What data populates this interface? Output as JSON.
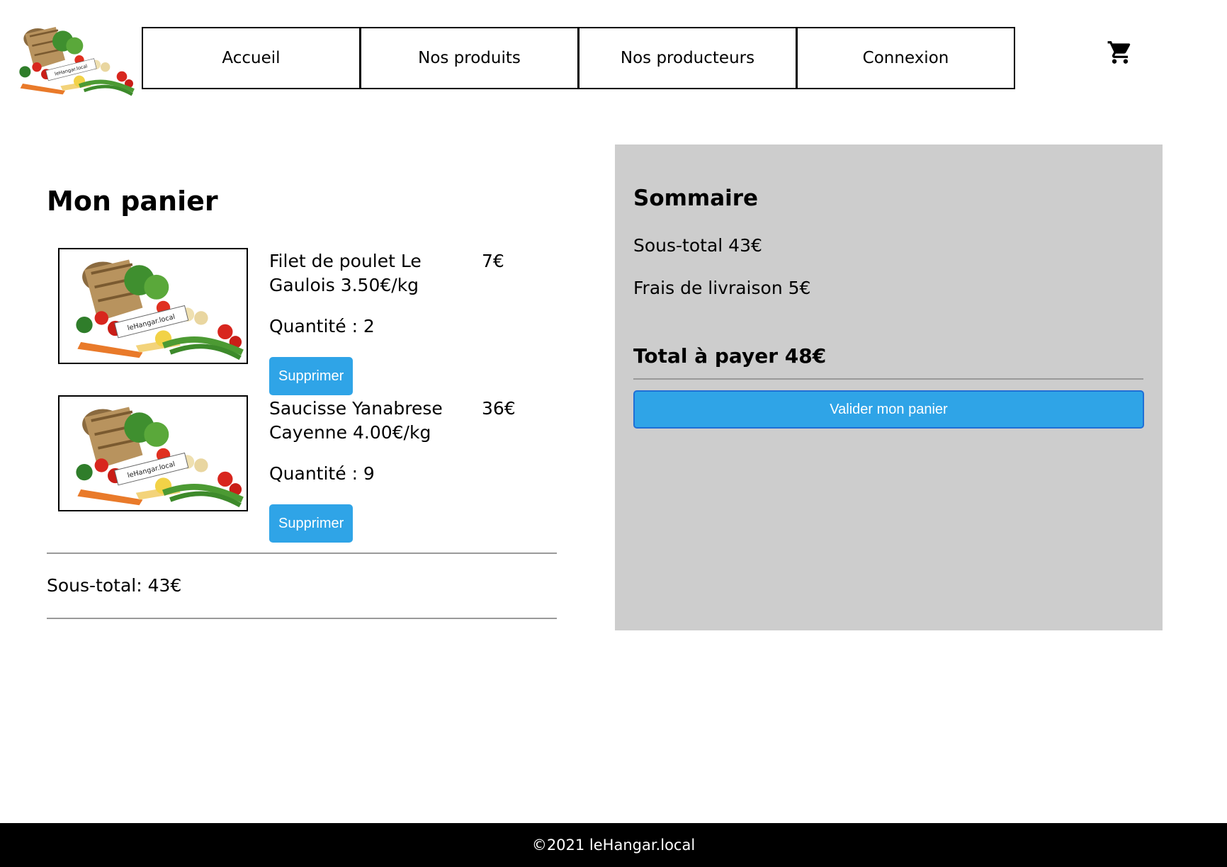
{
  "header": {
    "nav": [
      "Accueil",
      "Nos produits",
      "Nos producteurs",
      "Connexion"
    ],
    "logo_icon": "vegetable-basket-logo",
    "cart_icon": "shopping-cart-icon"
  },
  "cart": {
    "title": "Mon panier",
    "items": [
      {
        "name": "Filet de poulet Le Gaulois 3.50€/kg",
        "price": "7€",
        "quantity": "Quantité : 2",
        "delete_label": "Supprimer"
      },
      {
        "name": "Saucisse Yanabrese Cayenne 4.00€/kg",
        "price": "36€",
        "quantity": "Quantité : 9",
        "delete_label": "Supprimer"
      }
    ],
    "subtotal": "Sous-total: 43€"
  },
  "summary": {
    "title": "Sommaire",
    "subtotal": "Sous-total 43€",
    "shipping": "Frais de livraison 5€",
    "total": "Total à payer 48€",
    "validate_label": "Valider mon panier"
  },
  "footer": {
    "text": "©2021 leHangar.local"
  },
  "colors": {
    "accent": "#2fa4e7",
    "summary_bg": "#cdcdcd",
    "footer_bg": "#000000"
  }
}
